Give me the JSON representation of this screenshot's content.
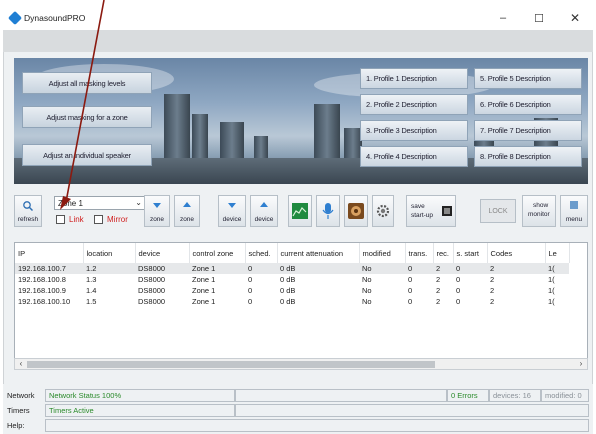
{
  "window": {
    "title": "DynasoundPRO",
    "minimize": "–",
    "maximize": "☐",
    "close": "✕"
  },
  "banner": {
    "buttons": [
      "Adjust all masking levels",
      "Adjust masking for a zone",
      "Adjust an individual speaker"
    ],
    "profiles": [
      "1. Profile 1 Description",
      "5. Profile 5 Description",
      "2. Profile 2 Description",
      "6. Profile 6 Description",
      "3. Profile 3 Description",
      "7. Profile 7 Description",
      "4. Profile 4 Description",
      "8. Profile 8 Description"
    ]
  },
  "toolbar": {
    "refresh": "refresh",
    "zone_value": "Zone 1",
    "link": "Link",
    "mirror": "Mirror",
    "zone_down": "zone",
    "zone_up": "zone",
    "device_down": "device",
    "device_up": "device",
    "save_startup_1": "save",
    "save_startup_2": "start-up",
    "lock": "LOCK",
    "show_monitor_1": "show",
    "show_monitor_2": "monitor",
    "menu": "menu"
  },
  "grid": {
    "headers": [
      "IP",
      "location",
      "device",
      "control zone",
      "sched.",
      "current attenuation",
      "modified",
      "trans.",
      "rec.",
      "s. start",
      "Codes",
      "Le"
    ],
    "rows": [
      [
        "192.168.100.7",
        "1.2",
        "DS8000",
        "Zone 1",
        "0",
        "0 dB",
        "No",
        "0",
        "2",
        "0",
        "2",
        "1("
      ],
      [
        "192.168.100.8",
        "1.3",
        "DS8000",
        "Zone 1",
        "0",
        "0 dB",
        "No",
        "0",
        "2",
        "0",
        "2",
        "1("
      ],
      [
        "192.168.100.9",
        "1.4",
        "DS8000",
        "Zone 1",
        "0",
        "0 dB",
        "No",
        "0",
        "2",
        "0",
        "2",
        "1("
      ],
      [
        "192.168.100.10",
        "1.5",
        "DS8000",
        "Zone 1",
        "0",
        "0 dB",
        "No",
        "0",
        "2",
        "0",
        "2",
        "1("
      ]
    ]
  },
  "status": {
    "network_label": "Network",
    "network_status": "Network Status 100%",
    "errors": "0 Errors",
    "devices": "devices: 16",
    "modified": "modified: 0",
    "timers_label": "Timers",
    "timers_status": "Timers Active",
    "help_label": "Help:"
  },
  "colors": {
    "accent": "#1f7fd4",
    "status_green": "#2a8a2a",
    "link_red": "#d02020"
  }
}
